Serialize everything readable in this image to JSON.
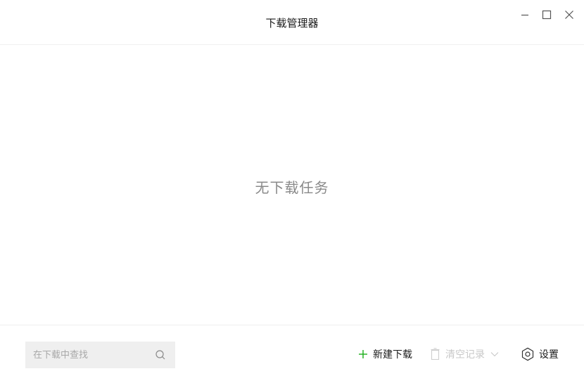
{
  "window": {
    "title": "下载管理器"
  },
  "main": {
    "empty_message": "无下载任务"
  },
  "footer": {
    "search_placeholder": "在下载中查找",
    "new_download_label": "新建下载",
    "clear_records_label": "清空记录",
    "settings_label": "设置"
  },
  "colors": {
    "accent_green": "#1aad19",
    "disabled_gray": "#c8c8c8",
    "empty_text_gray": "#8a8a8a"
  },
  "icons": {
    "minimize": "minimize-icon",
    "maximize": "maximize-icon",
    "close": "close-icon",
    "search": "search-icon",
    "add": "plus-icon",
    "trash": "trash-icon",
    "dropdown": "chevron-down-icon",
    "settings": "gear-icon"
  }
}
